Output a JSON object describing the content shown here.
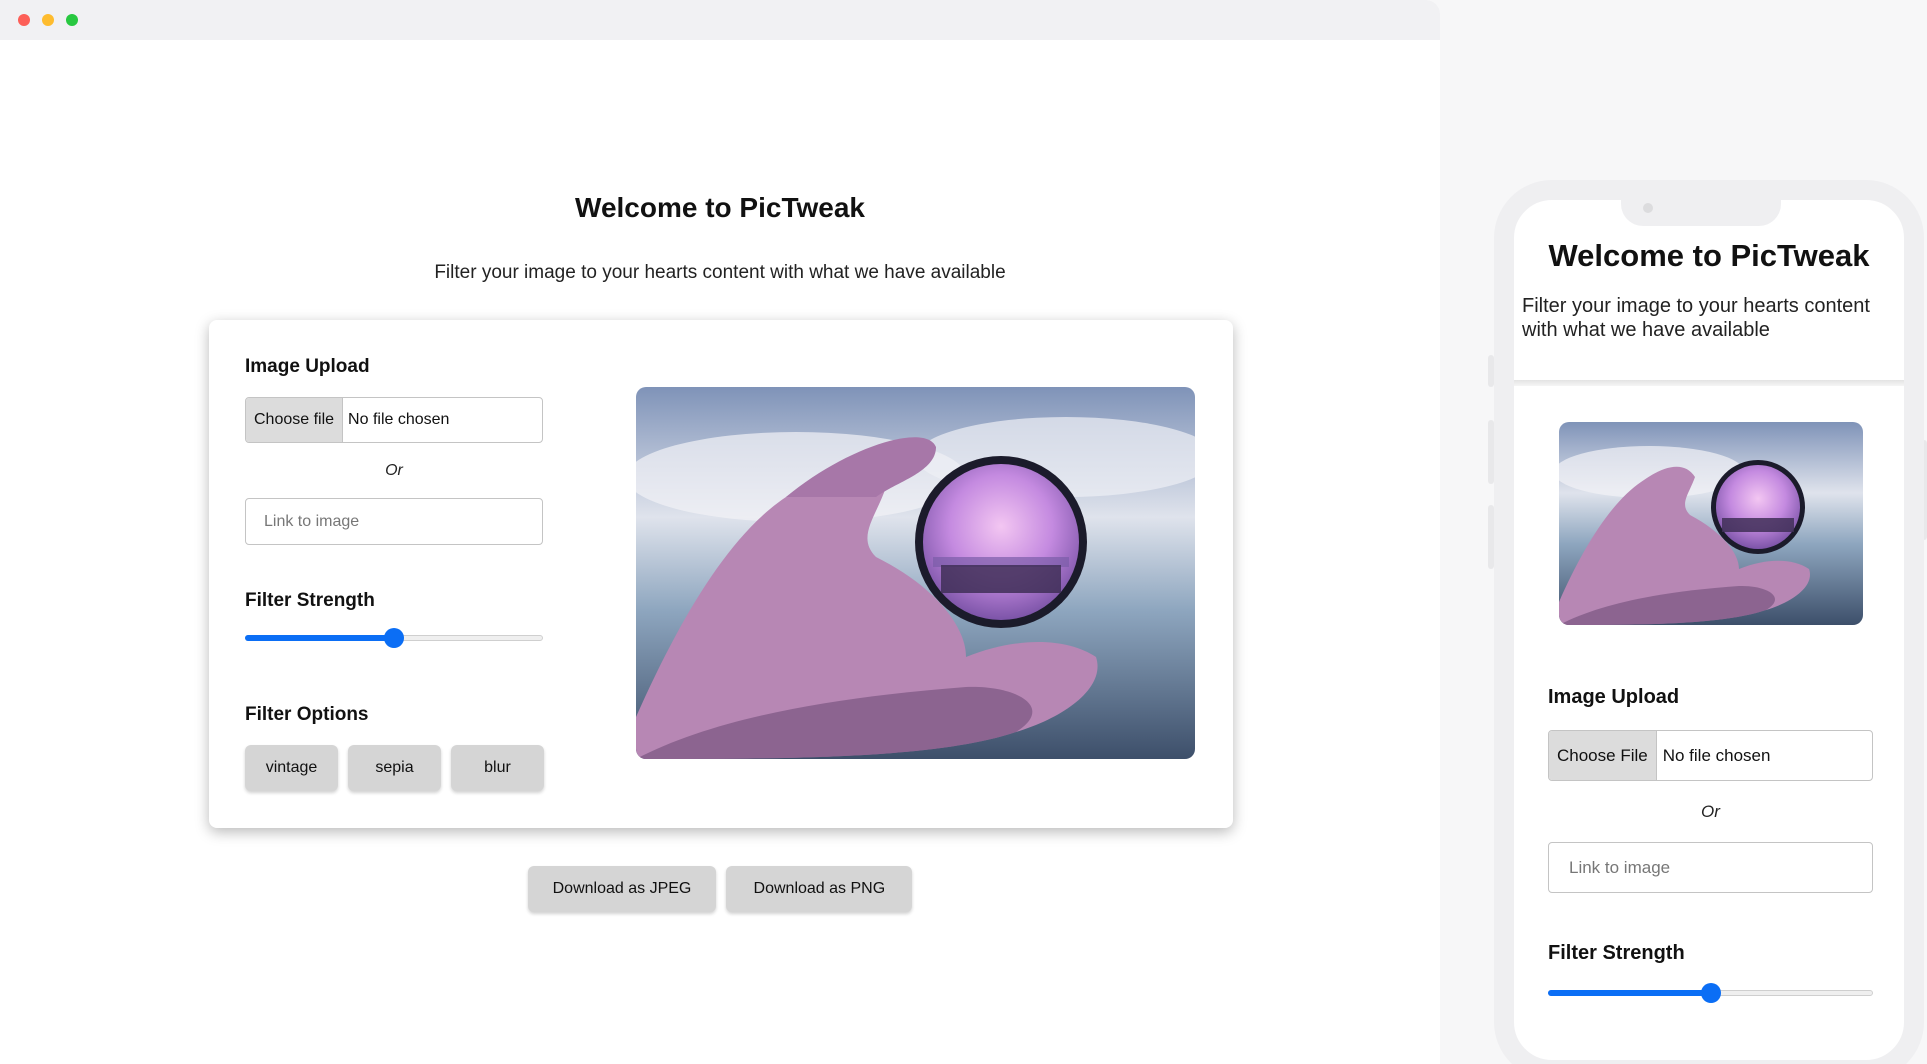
{
  "window": {
    "controls": [
      "close",
      "minimize",
      "maximize"
    ]
  },
  "desktop": {
    "title": "Welcome to PicTweak",
    "subtitle": "Filter your image to your hearts content with what we have available",
    "upload_label": "Image Upload",
    "choose_file_label": "Choose file",
    "no_file_text": "No file chosen",
    "or_text": "Or",
    "link_placeholder": "Link to image",
    "strength_label": "Filter Strength",
    "strength_value": 0.5,
    "options_label": "Filter Options",
    "filters": [
      "vintage",
      "sepia",
      "blur"
    ],
    "download_jpeg": "Download as JPEG",
    "download_png": "Download as PNG"
  },
  "mobile": {
    "title": "Welcome to PicTweak",
    "subtitle": "Filter your image to your hearts content with what we have available",
    "upload_label": "Image Upload",
    "choose_file_label": "Choose File",
    "no_file_text": "No file chosen",
    "or_text": "Or",
    "link_placeholder": "Link to image",
    "strength_label": "Filter Strength",
    "strength_value": 0.5
  },
  "colors": {
    "accent": "#0b6ef5",
    "button_bg": "#d5d5d5",
    "photo_tint": "#b98fd0"
  },
  "image": {
    "subject": "hand holding a lens filter showing a purple tinted seaside"
  }
}
